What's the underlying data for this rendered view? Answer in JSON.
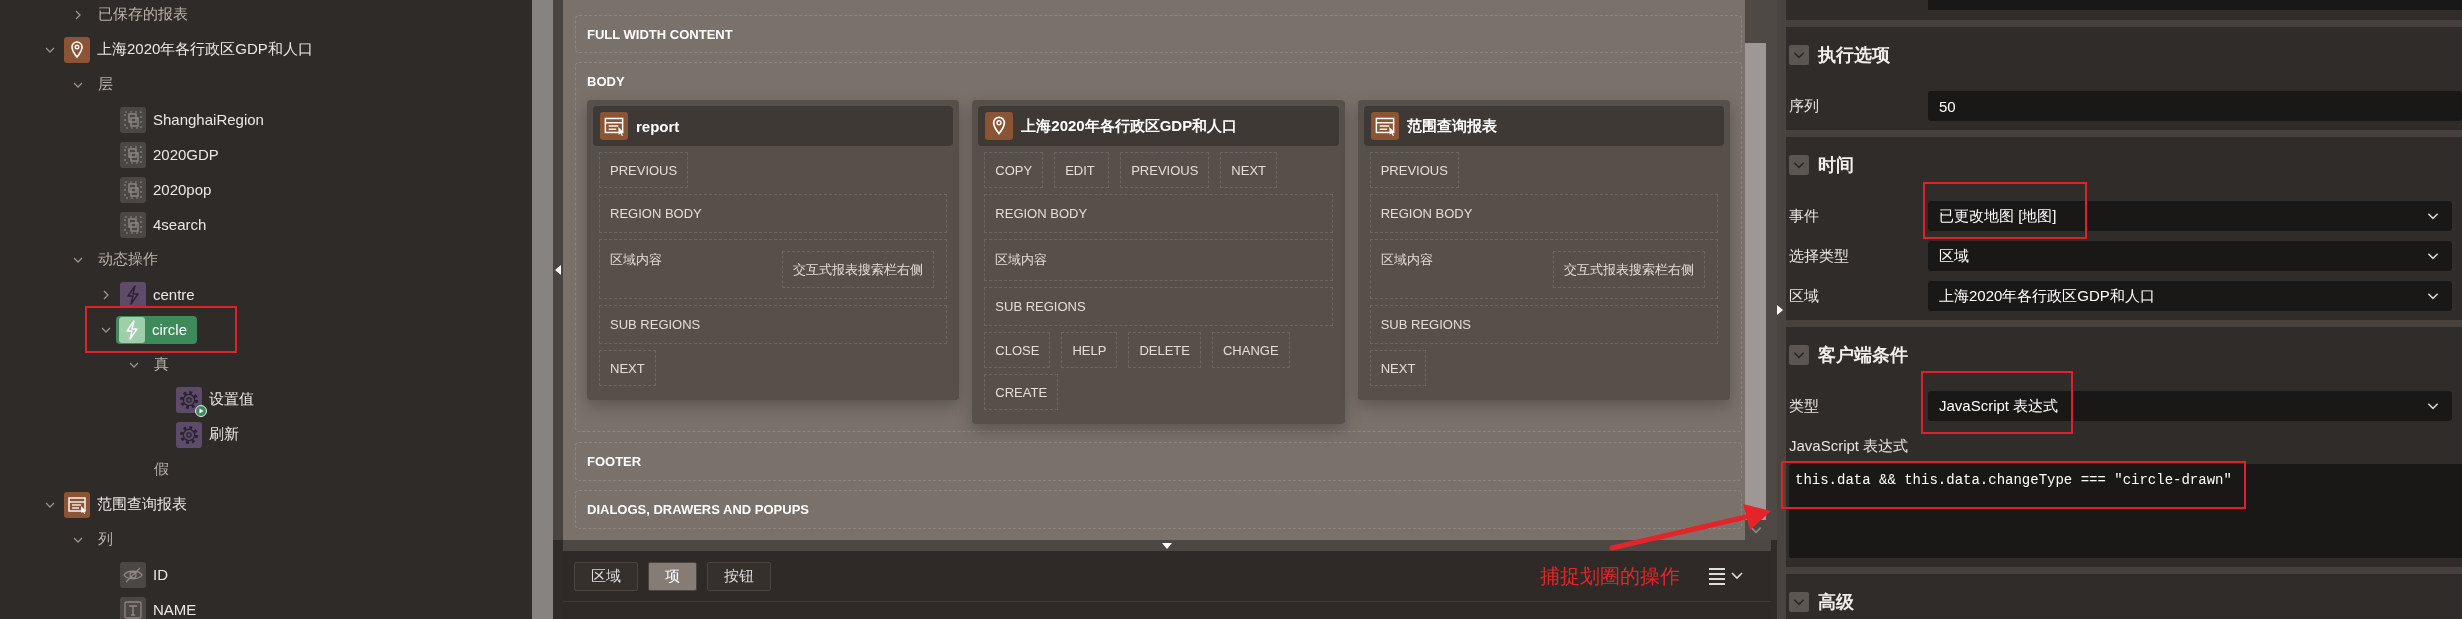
{
  "tree": {
    "orphans": [
      {
        "label": "已保存的报表",
        "kind": "folder",
        "expanded": false,
        "selected": false
      }
    ],
    "items": [
      {
        "label": "上海2020年各行政区GDP和人口",
        "kind": "map",
        "expanded": true,
        "selected": false,
        "children": [
          {
            "label": "层",
            "kind": "folder",
            "expanded": true,
            "selected": false,
            "children": [
              {
                "label": "ShanghaiRegion",
                "kind": "layer",
                "selected": false
              },
              {
                "label": "2020GDP",
                "kind": "layer",
                "selected": false
              },
              {
                "label": "2020pop",
                "kind": "layer",
                "selected": false
              },
              {
                "label": "4search",
                "kind": "layer",
                "selected": false
              }
            ]
          },
          {
            "label": "动态操作",
            "kind": "folder",
            "expanded": true,
            "selected": false,
            "children": [
              {
                "label": "centre",
                "kind": "dynamic-action",
                "expanded": false,
                "selected": false
              },
              {
                "label": "circle",
                "kind": "dynamic-action",
                "expanded": true,
                "selected": true,
                "children": [
                  {
                    "label": "真",
                    "kind": "folder",
                    "expanded": true,
                    "selected": false,
                    "children": [
                      {
                        "label": "设置值",
                        "kind": "action",
                        "selected": false,
                        "badge": true
                      },
                      {
                        "label": "刷新",
                        "kind": "action",
                        "selected": false,
                        "badge": false
                      }
                    ]
                  },
                  {
                    "label": "假",
                    "kind": "folder",
                    "selected": false
                  }
                ]
              }
            ]
          }
        ]
      },
      {
        "label": "范围查询报表",
        "kind": "report",
        "expanded": true,
        "selected": false,
        "children": [
          {
            "label": "列",
            "kind": "folder",
            "expanded": true,
            "selected": false,
            "children": [
              {
                "label": "ID",
                "kind": "hidden-column",
                "selected": false
              },
              {
                "label": "NAME",
                "kind": "text-column",
                "selected": false
              }
            ]
          }
        ]
      }
    ]
  },
  "canvas": {
    "regions": [
      {
        "title": "FULL WIDTH CONTENT"
      },
      {
        "title": "BODY",
        "cards": [
          {
            "title": "report",
            "kind": "report",
            "rows": [
              {
                "kind": "buttons",
                "items": [
                  "PREVIOUS"
                ]
              },
              {
                "kind": "slot",
                "label": "REGION BODY"
              },
              {
                "kind": "slot",
                "label": "区域内容",
                "side": "交互式报表搜索栏右侧"
              },
              {
                "kind": "slot",
                "label": "SUB REGIONS"
              },
              {
                "kind": "buttons",
                "items": [
                  "NEXT"
                ]
              }
            ]
          },
          {
            "title": "上海2020年各行政区GDP和人口",
            "kind": "map",
            "rows": [
              {
                "kind": "buttons",
                "items": [
                  "COPY",
                  "EDIT",
                  "PREVIOUS",
                  "NEXT"
                ]
              },
              {
                "kind": "slot",
                "label": "REGION BODY"
              },
              {
                "kind": "slot",
                "label": "区域内容"
              },
              {
                "kind": "slot",
                "label": "SUB REGIONS"
              },
              {
                "kind": "buttons",
                "items": [
                  "CLOSE",
                  "HELP",
                  "DELETE",
                  "CHANGE"
                ]
              },
              {
                "kind": "buttons",
                "items": [
                  "CREATE"
                ]
              }
            ]
          },
          {
            "title": "范围查询报表",
            "kind": "report",
            "rows": [
              {
                "kind": "buttons",
                "items": [
                  "PREVIOUS"
                ]
              },
              {
                "kind": "slot",
                "label": "REGION BODY"
              },
              {
                "kind": "slot",
                "label": "区域内容",
                "side": "交互式报表搜索栏右侧"
              },
              {
                "kind": "slot",
                "label": "SUB REGIONS"
              },
              {
                "kind": "buttons",
                "items": [
                  "NEXT"
                ]
              }
            ]
          }
        ]
      },
      {
        "title": "FOOTER"
      },
      {
        "title": "DIALOGS, DRAWERS AND POPUPS"
      }
    ]
  },
  "bottom_bar": {
    "tabs": [
      {
        "label": "区域",
        "selected": false
      },
      {
        "label": "项",
        "selected": true
      },
      {
        "label": "按钮",
        "selected": false
      }
    ]
  },
  "properties": {
    "sections": [
      {
        "title": "执行选项",
        "expanded": true,
        "fields": [
          {
            "label": "序列",
            "kind": "text",
            "value": "50"
          }
        ]
      },
      {
        "title": "时间",
        "expanded": true,
        "fields": [
          {
            "label": "事件",
            "kind": "select",
            "value": "已更改地图 [地图]"
          },
          {
            "label": "选择类型",
            "kind": "select",
            "value": "区域"
          },
          {
            "label": "区域",
            "kind": "select",
            "value": "上海2020年各行政区GDP和人口"
          }
        ]
      },
      {
        "title": "客户端条件",
        "expanded": true,
        "fields": [
          {
            "label": "类型",
            "kind": "select",
            "value": "JavaScript 表达式"
          },
          {
            "label": "JavaScript 表达式",
            "kind": "code",
            "value": "this.data && this.data.changeType === \"circle-drawn\""
          }
        ]
      },
      {
        "title": "高级",
        "expanded": true
      }
    ]
  },
  "annotation": {
    "note": "捕捉划圈的操作"
  }
}
